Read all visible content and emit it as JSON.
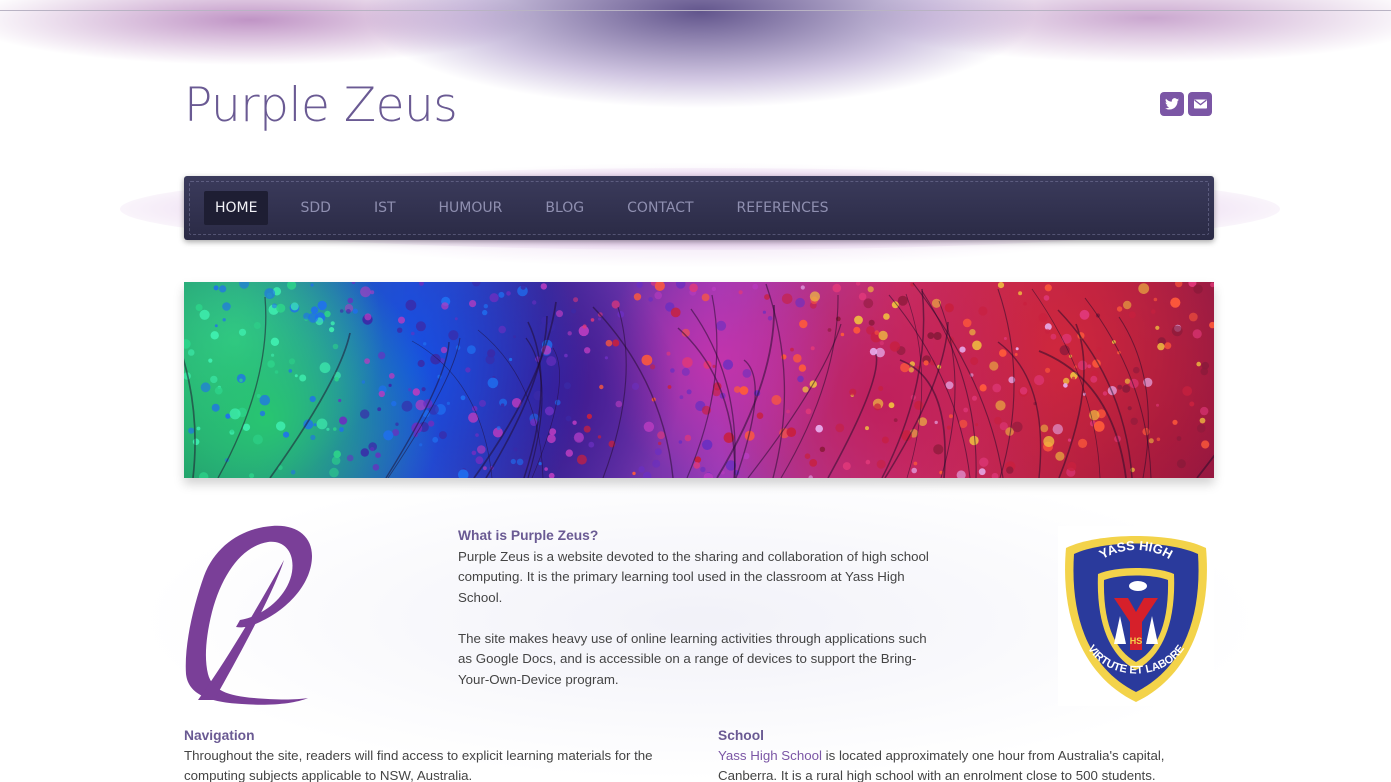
{
  "site": {
    "title": "Purple Zeus"
  },
  "social": [
    {
      "icon": "twitter-icon",
      "glyph": "🐦"
    },
    {
      "icon": "email-icon",
      "glyph": "✉"
    }
  ],
  "nav": {
    "items": [
      {
        "label": "HOME",
        "active": true
      },
      {
        "label": "SDD"
      },
      {
        "label": "IST"
      },
      {
        "label": "HUMOUR"
      },
      {
        "label": "BLOG"
      },
      {
        "label": "CONTACT"
      },
      {
        "label": "REFERENCES"
      }
    ]
  },
  "intro": {
    "heading": "What is Purple Zeus?",
    "p1": "Purple Zeus is a website devoted to the sharing and collaboration of high school computing. It is the primary learning tool used in the classroom at Yass High School.",
    "p2": "The site makes heavy use of online learning activities through applications such as Google Docs, and is accessible on a range of devices to support the Bring-Your-Own-Device program."
  },
  "crest": {
    "top_text": "YASS HIGH",
    "bottom_text": "VIRTUTE ET LABORE",
    "initials": "HS"
  },
  "navigation_section": {
    "heading": "Navigation",
    "text": "Throughout the site, readers will find access to explicit learning materials for the computing subjects applicable to NSW, Australia."
  },
  "school_section": {
    "heading": "School",
    "link": "Yass High School",
    "text": " is located approximately one hour from Australia's capital, Canberra. It is a rural high school with an enrolment close to 500 students."
  },
  "colors": {
    "accent": "#7b56a5",
    "title": "#6a5a93",
    "nav_bg": "#2f2f4d"
  }
}
